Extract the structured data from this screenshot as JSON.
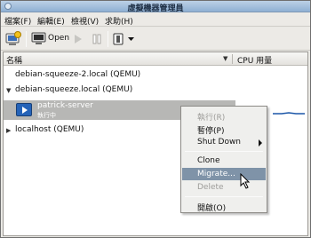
{
  "window": {
    "title": "虛擬機器管理員"
  },
  "menubar": {
    "items": [
      "檔案(F)",
      "編輯(E)",
      "檢視(V)",
      "求助(H)"
    ]
  },
  "toolbar": {
    "open_label": "Open"
  },
  "columns": {
    "name": "名稱",
    "cpu": "CPU 用量"
  },
  "tree": [
    {
      "label": "debian-squeeze-2.local (QEMU)",
      "expanded": false
    },
    {
      "label": "debian-squeeze.local (QEMU)",
      "expanded": true,
      "children": [
        {
          "name": "patrick-server",
          "status": "執行中"
        }
      ]
    },
    {
      "label": "localhost (QEMU)",
      "expanded": false
    }
  ],
  "context_menu": [
    {
      "label": "執行(R)",
      "enabled": false
    },
    {
      "label": "暫停(P)",
      "enabled": true
    },
    {
      "label": "Shut Down",
      "enabled": true,
      "submenu": true
    },
    {
      "label": "Clone",
      "enabled": true
    },
    {
      "label": "Migrate...",
      "enabled": true,
      "highlighted": true
    },
    {
      "label": "Delete",
      "enabled": false
    },
    {
      "label": "開啟(O)",
      "enabled": true
    }
  ],
  "colors": {
    "accent": "#2563b8",
    "selection": "#b7b7b5",
    "menu_hover": "#7f93a8"
  }
}
